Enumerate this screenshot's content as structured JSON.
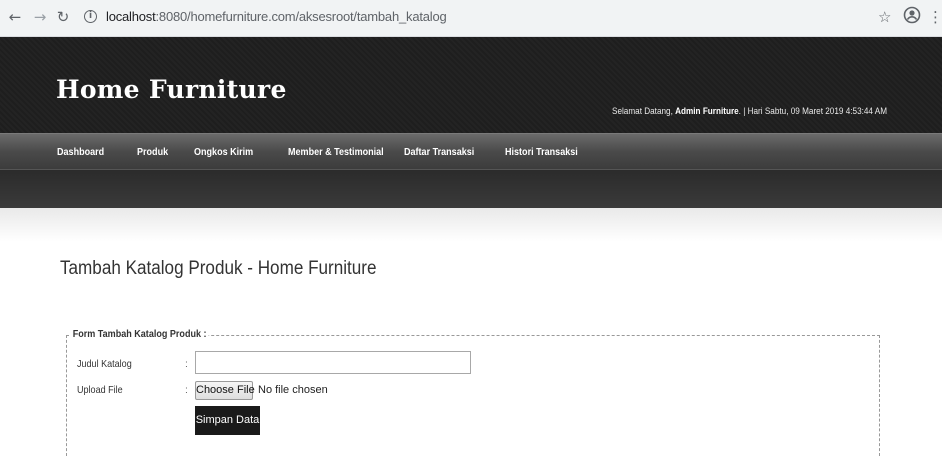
{
  "browser": {
    "url_host": "localhost",
    "url_rest": ":8080/homefurniture.com/aksesroot/tambah_katalog"
  },
  "header": {
    "logo": "Home Furniture",
    "welcome_prefix": "Selamat Datang, ",
    "welcome_user": "Admin Furniture",
    "welcome_suffix": ". | ",
    "welcome_date": "Hari Sabtu, 09 Maret 2019 4:53:44 AM"
  },
  "menu": {
    "items": [
      "Dashboard",
      "Produk",
      "Ongkos Kirim",
      "Member & Testimonial",
      "Daftar Transaksi",
      "Histori Transaksi"
    ]
  },
  "page": {
    "title": "Tambah Katalog Produk - Home Furniture"
  },
  "form": {
    "legend": "Form Tambah Katalog Produk :",
    "judul_label": "Judul Katalog",
    "judul_value": "",
    "upload_label": "Upload File",
    "colon": ":",
    "choose_file": "Choose File",
    "file_status": "No file chosen",
    "submit": "Simpan Data"
  },
  "icons": {
    "back": "back-arrow-icon",
    "forward": "forward-arrow-icon",
    "reload": "reload-icon",
    "info": "info-icon",
    "star": "bookmark-star-icon",
    "profile": "profile-icon",
    "menu": "kebab-menu-icon"
  }
}
